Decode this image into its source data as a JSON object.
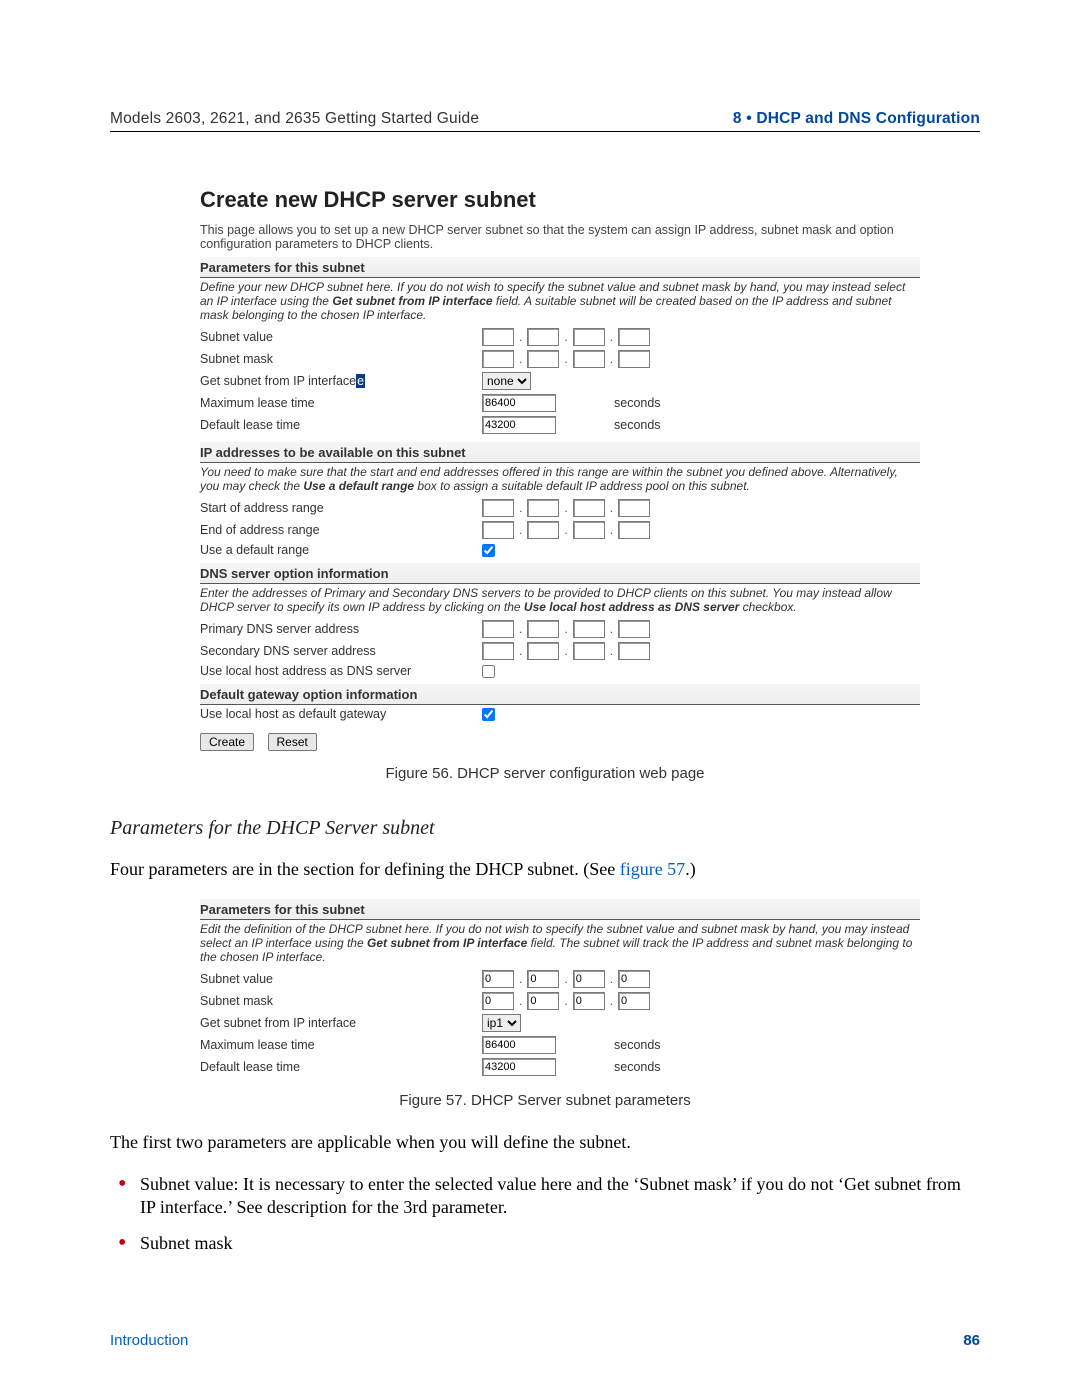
{
  "header": {
    "left": "Models 2603, 2621, and 2635 Getting Started Guide",
    "right": "8 • DHCP and DNS Configuration"
  },
  "fig56": {
    "title": "Create new DHCP server subnet",
    "desc": "This page allows you to set up a new DHCP server subnet so that the system can assign IP address, subnet mask and option configuration parameters to DHCP clients.",
    "s1": {
      "head": "Parameters for this subnet",
      "sub_a": "Define your new DHCP subnet here. If you do not wish to specify the subnet value and subnet mask by hand, you may instead select an IP interface using the ",
      "sub_b": "Get subnet from IP interface",
      "sub_c": " field. A suitable subnet will be created based on the IP address and subnet mask belonging to the chosen IP interface.",
      "r1": "Subnet value",
      "r2": "Subnet mask",
      "r3": "Get subnet from IP interface",
      "r3_sel": "none",
      "r4": "Maximum lease time",
      "r4_val": "86400",
      "r5": "Default lease time",
      "r5_val": "43200",
      "unit": "seconds"
    },
    "s2": {
      "head": "IP addresses to be available on this subnet",
      "sub_a": "You need to make sure that the start and end addresses offered in this range are within the subnet you defined above. Alternatively, you may check the ",
      "sub_b": "Use a default range",
      "sub_c": " box to assign a suitable default IP address pool on this subnet.",
      "r1": "Start of address range",
      "r2": "End of address range",
      "r3": "Use a default range"
    },
    "s3": {
      "head": "DNS server option information",
      "sub_a": "Enter the addresses of Primary and Secondary DNS servers to be provided to DHCP clients on this subnet. You may instead allow DHCP server to specify its own IP address by clicking on the ",
      "sub_b": "Use local host address as DNS server",
      "sub_c": " checkbox.",
      "r1": "Primary DNS server address",
      "r2": "Secondary DNS server address",
      "r3": "Use local host address as DNS server"
    },
    "s4": {
      "head": "Default gateway option information",
      "r1": "Use local host as default gateway"
    },
    "btn_create": "Create",
    "btn_reset": "Reset",
    "caption": "Figure 56. DHCP server configuration web page"
  },
  "section_title": "Parameters for the DHCP Server subnet",
  "section_para_a": "Four parameters are in the section for defining the DHCP subnet. (See ",
  "section_link": "figure 57",
  "section_para_b": ".)",
  "fig57": {
    "s1": {
      "head": "Parameters for this subnet",
      "sub_a": "Edit the definition of the DHCP subnet here. If you do not wish to specify the subnet value and subnet mask by hand, you may instead select an IP interface using the ",
      "sub_b": "Get subnet from IP interface",
      "sub_c": " field. The subnet will track the IP address and subnet mask belonging to the chosen IP interface.",
      "r1": "Subnet value",
      "r2": "Subnet mask",
      "ipseg": "0",
      "r3": "Get subnet from IP interface",
      "r3_sel": "ip1",
      "r4": "Maximum lease time",
      "r4_val": "86400",
      "r5": "Default lease time",
      "r5_val": "43200",
      "unit": "seconds"
    },
    "caption": "Figure 57. DHCP Server subnet parameters"
  },
  "body_after": "The first two parameters are applicable when you will define the subnet.",
  "bullets": {
    "b1": "Subnet value: It is necessary to enter the selected value here and the ‘Subnet mask’ if you do not ‘Get subnet from IP interface.’ See description for the 3rd parameter.",
    "b2": "Subnet mask"
  },
  "footer": {
    "left": "Introduction",
    "right": "86"
  }
}
